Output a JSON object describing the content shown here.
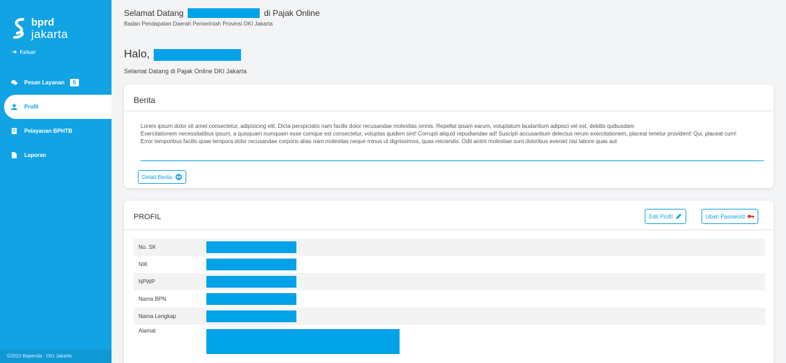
{
  "app": {
    "logo_line1": "bprd",
    "logo_line2": "jakarta",
    "logout_label": "Keluar",
    "footer": "©2022 Bapenda - DKI Jakarta"
  },
  "sidebar": {
    "items": [
      {
        "label": "Pesan Layanan",
        "badge": "0",
        "icon": "chat-icon"
      },
      {
        "label": "Profil",
        "icon": "user-icon"
      },
      {
        "label": "Pelayanan BPHTB",
        "icon": "document-icon"
      },
      {
        "label": "Laporan",
        "icon": "file-icon"
      }
    ]
  },
  "header": {
    "welcome_prefix": "Selamat Datang",
    "welcome_suffix": "di Pajak Online",
    "subtitle": "Badan Pendapatan Daerah Pemerintah Provinsi DKI Jakarta",
    "greeting": "Halo,",
    "greeting_sub": "Selamat Datang di Pajak Online DKI Jakarta"
  },
  "berita": {
    "title": "Berita",
    "body_1": "Lorem ipsum dolor sit amet consectetur, adipisicing elit. Dicta perspiciatis nam facilis dolor recusandae molestias omnis. Repellat ipsam earum, voluptatum laudantium adipisci vel est, debitis quibusdam",
    "body_2": "Exercitationem necessitatibus ipsum, a quisquam numquam esse cumque est consectetur, voluptas quidem sint! Corrupti aliquid repudiandae ad! Suscipit accusantium delectus rerum exercitationem, placeat tenetur provident! Qui, placeat cum!",
    "body_3": "Error temporibus facilis quae tempora dolor recusandae corporis alias nam molestias neque minus ut dignissimos, quas reiciendis. Odit animi molestiae sunt doloribus eveniet nisi labore quas aut",
    "detail_button": "Detail Berita"
  },
  "profil": {
    "title": "PROFIL",
    "edit_button": "Edit Profil",
    "password_button": "Ubah Password",
    "rows": [
      {
        "label": "No. SK"
      },
      {
        "label": "NIK"
      },
      {
        "label": "NPWP"
      },
      {
        "label": "Nama BPN"
      },
      {
        "label": "Nama Lengkap"
      },
      {
        "label": "Alamat"
      }
    ]
  },
  "colors": {
    "accent": "#11a3e3",
    "redaction": "#00a2e8"
  }
}
